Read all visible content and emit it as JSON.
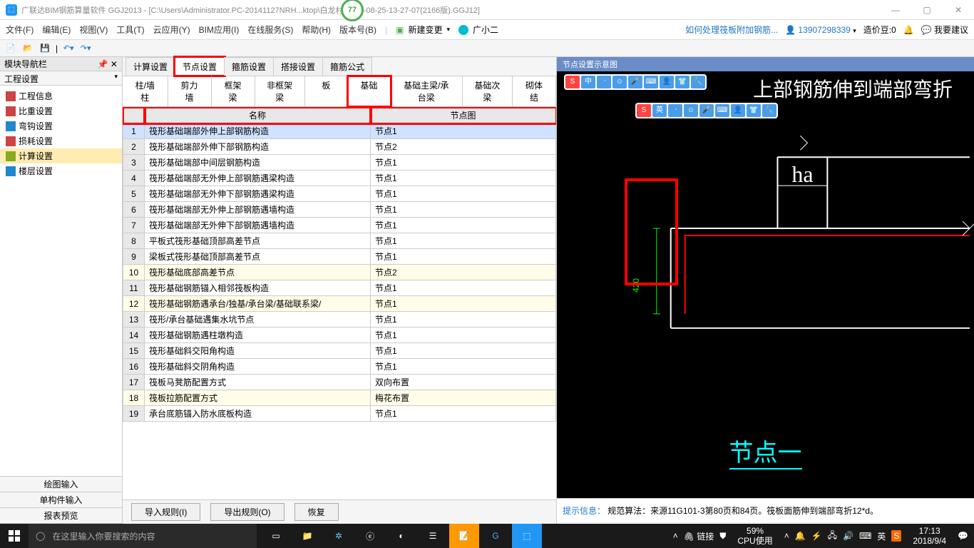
{
  "window": {
    "title": "广联达BIM钢筋算量软件 GGJ2013 - [C:\\Users\\Administrator.PC-20141127NRH...ktop\\白龙村-2016-08-25-13-27-07(2166版).GGJ12]",
    "score": "77"
  },
  "menu": {
    "items": [
      "文件(F)",
      "编辑(E)",
      "视图(V)",
      "工具(T)",
      "云应用(Y)",
      "BIM应用(I)",
      "在线服务(S)",
      "帮助(H)",
      "版本号(B)"
    ],
    "newChange": "新建变更",
    "user": "广小二",
    "question": "如何处理筏板附加钢筋...",
    "phone": "13907298339",
    "coinLabel": "造价豆:0",
    "feedback": "我要建议"
  },
  "leftPanel": {
    "navTitle": "模块导航栏",
    "subTitle": "工程设置",
    "items": [
      "工程信息",
      "比重设置",
      "弯钩设置",
      "损耗设置",
      "计算设置",
      "楼层设置"
    ],
    "selectedIndex": 4,
    "bottom": [
      "绘图输入",
      "单构件输入",
      "报表预览"
    ]
  },
  "centerTabs": {
    "upper": [
      "计算设置",
      "节点设置",
      "箍筋设置",
      "搭接设置",
      "箍筋公式"
    ],
    "upperActive": 1,
    "lower": [
      "柱/墙柱",
      "剪力墙",
      "框架梁",
      "非框架梁",
      "板",
      "基础",
      "基础主梁/承台梁",
      "基础次梁",
      "砌体结"
    ],
    "lowerActive": 5
  },
  "grid": {
    "headers": [
      "名称",
      "节点图"
    ],
    "rows": [
      {
        "n": 1,
        "name": "筏形基础端部外伸上部钢筋构造",
        "node": "节点1",
        "sel": true
      },
      {
        "n": 2,
        "name": "筏形基础端部外伸下部钢筋构造",
        "node": "节点2"
      },
      {
        "n": 3,
        "name": "筏形基础端部中间层钢筋构造",
        "node": "节点1"
      },
      {
        "n": 4,
        "name": "筏形基础端部无外伸上部钢筋遇梁构造",
        "node": "节点1"
      },
      {
        "n": 5,
        "name": "筏形基础端部无外伸下部钢筋遇梁构造",
        "node": "节点1"
      },
      {
        "n": 6,
        "name": "筏形基础端部无外伸上部钢筋遇墙构造",
        "node": "节点1"
      },
      {
        "n": 7,
        "name": "筏形基础端部无外伸下部钢筋遇墙构造",
        "node": "节点1"
      },
      {
        "n": 8,
        "name": "平板式筏形基础顶部高差节点",
        "node": "节点1"
      },
      {
        "n": 9,
        "name": "梁板式筏形基础顶部高差节点",
        "node": "节点1"
      },
      {
        "n": 10,
        "name": "筏形基础底部高差节点",
        "node": "节点2",
        "alt": true
      },
      {
        "n": 11,
        "name": "筏形基础钢筋锚入相邻筏板构造",
        "node": "节点1"
      },
      {
        "n": 12,
        "name": "筏形基础钢筋遇承台/独基/承台梁/基础联系梁/",
        "node": "节点1",
        "alt": true
      },
      {
        "n": 13,
        "name": "筏形/承台基础遇集水坑节点",
        "node": "节点1"
      },
      {
        "n": 14,
        "name": "筏形基础钢筋遇柱墩构造",
        "node": "节点1"
      },
      {
        "n": 15,
        "name": "筏形基础斜交阳角构造",
        "node": "节点1"
      },
      {
        "n": 16,
        "name": "筏形基础斜交阴角构造",
        "node": "节点1"
      },
      {
        "n": 17,
        "name": "筏板马凳筋配置方式",
        "node": "双向布置"
      },
      {
        "n": 18,
        "name": "筏板拉筋配置方式",
        "node": "梅花布置",
        "alt": true
      },
      {
        "n": 19,
        "name": "承台底筋锚入防水底板构造",
        "node": "节点1"
      }
    ]
  },
  "actions": {
    "import": "导入规则(I)",
    "export": "导出规则(O)",
    "restore": "恢复"
  },
  "rightPanel": {
    "header": "节点设置示意图",
    "diagramTitle": "上部钢筋伸到端部弯折",
    "labels": {
      "ha": "ha",
      "v420": "420",
      "node": "节点一"
    },
    "hintLabel": "提示信息：",
    "hintText": "规范算法：来源11G101-3第80页和84页。筏板面筋伸到端部弯折12*d。"
  },
  "taskbar": {
    "searchPlaceholder": "在这里输入你要搜索的内容",
    "link": "链接",
    "cpuPct": "59%",
    "cpuLabel": "CPU使用",
    "time": "17:13",
    "date": "2018/9/4",
    "lang": "英"
  }
}
